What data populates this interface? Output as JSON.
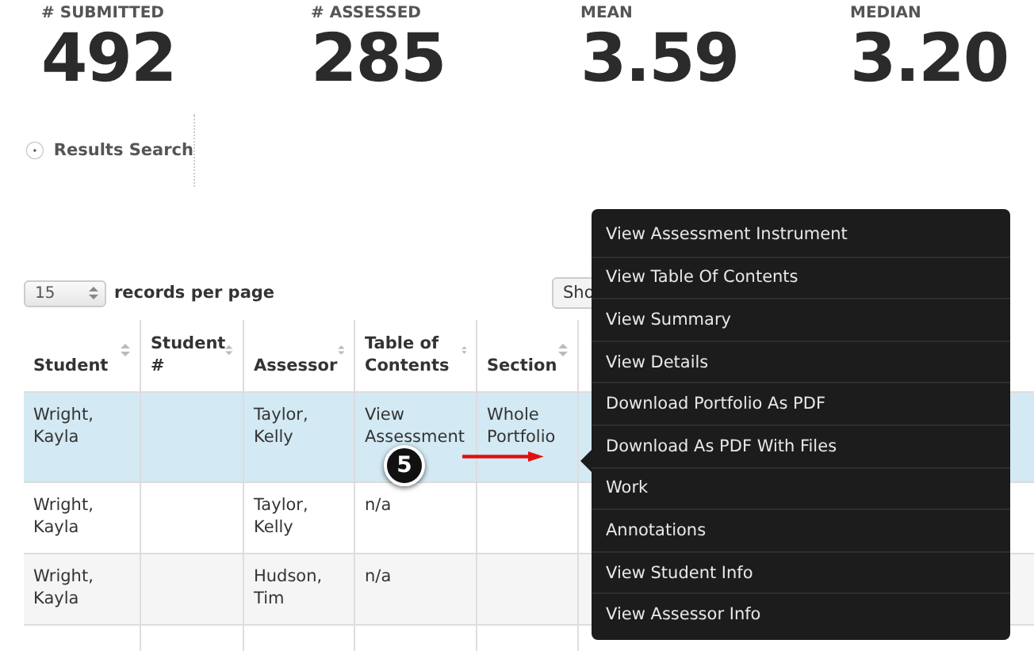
{
  "stats": [
    {
      "label": "# SUBMITTED",
      "value": "492"
    },
    {
      "label": "# ASSESSED",
      "value": "285"
    },
    {
      "label": "MEAN",
      "value": "3.59"
    },
    {
      "label": "MEDIAN",
      "value": "3.20"
    }
  ],
  "results_search": {
    "label": "Results Search"
  },
  "page_size": {
    "value": "15",
    "label": "records per page"
  },
  "toolbar": {
    "buttons": [
      "Sho"
    ]
  },
  "table": {
    "columns": [
      "Student",
      "Student #",
      "Assessor",
      "Table of Contents",
      "Section"
    ],
    "rows": [
      {
        "selected": true,
        "cells": [
          "Wright, Kayla",
          "",
          "Taylor, Kelly",
          "View Assessment",
          "Whole Portfolio"
        ]
      },
      {
        "selected": false,
        "cells": [
          "Wright, Kayla",
          "",
          "Taylor, Kelly",
          "n/a",
          ""
        ]
      },
      {
        "selected": false,
        "cells": [
          "Wright, Kayla",
          "",
          "Hudson, Tim",
          "n/a",
          ""
        ]
      }
    ]
  },
  "context_menu": {
    "items": [
      "View Assessment Instrument",
      "View Table Of Contents",
      "View Summary",
      "View Details",
      "Download Portfolio As PDF",
      "Download As PDF With Files",
      "Work",
      "Annotations",
      "View Student Info",
      "View Assessor Info"
    ]
  },
  "callout": {
    "number": "5"
  }
}
